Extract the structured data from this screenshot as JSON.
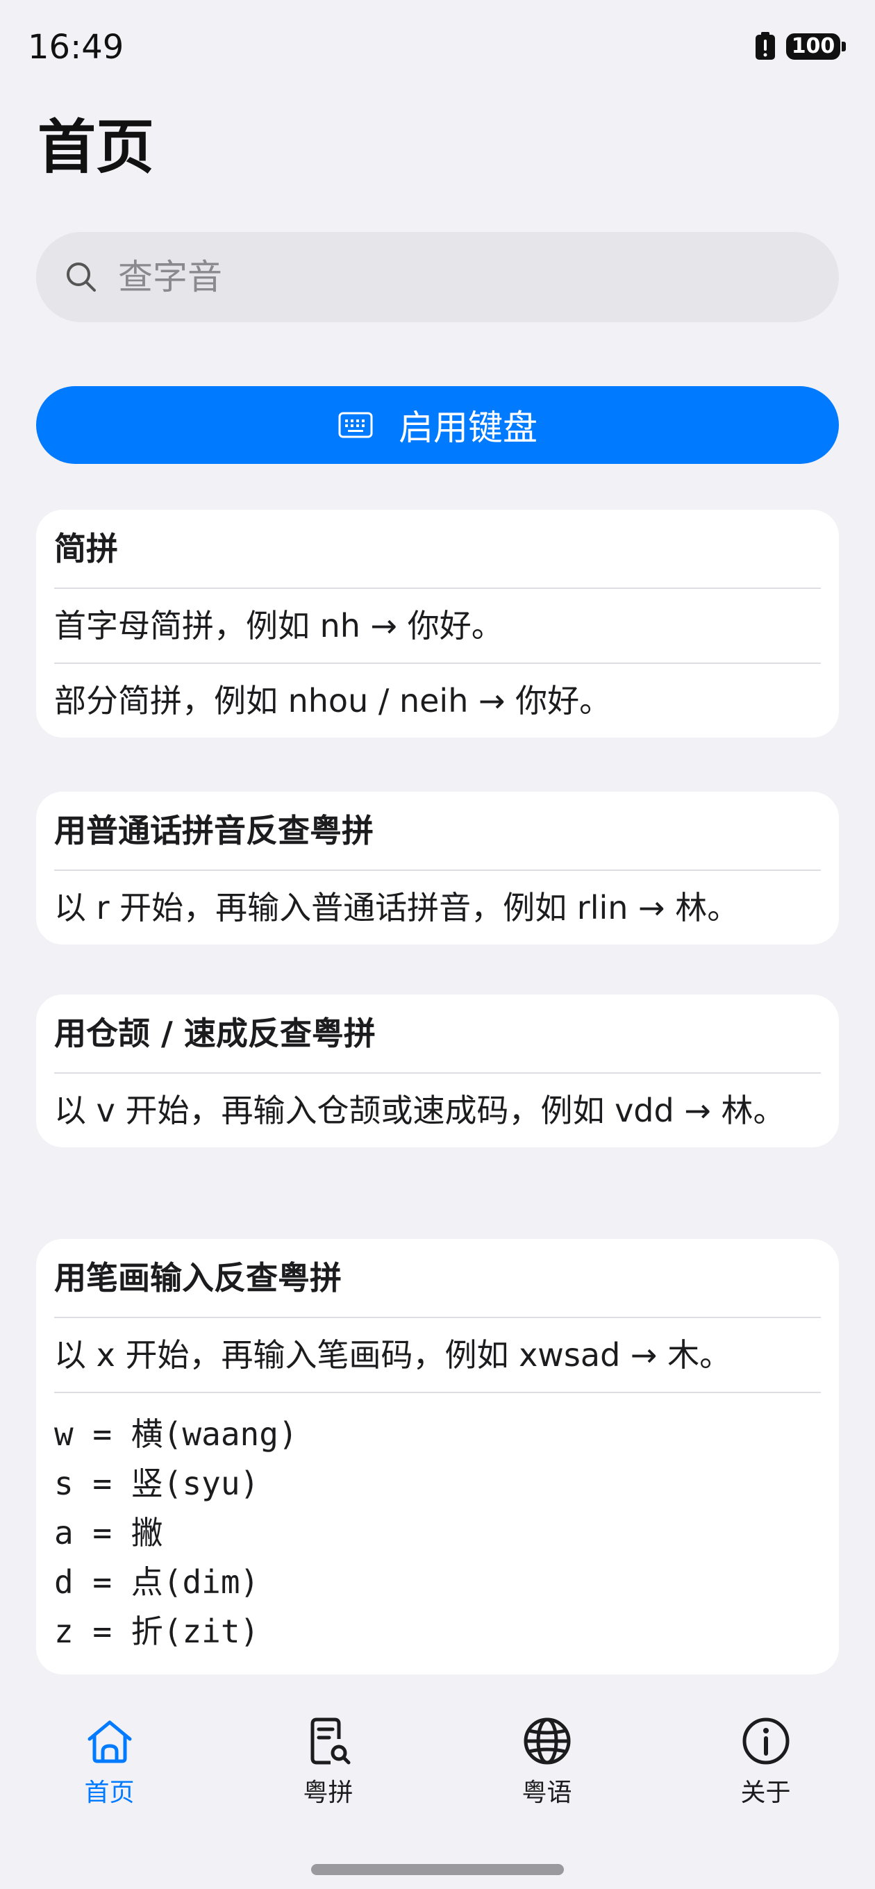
{
  "status": {
    "time": "16:49",
    "battery": "100"
  },
  "page": {
    "title": "首页"
  },
  "search": {
    "placeholder": "查字音",
    "value": ""
  },
  "primary_button": {
    "label": "启用键盘"
  },
  "cards": {
    "abbrev": {
      "title": "简拼",
      "rows": [
        "首字母简拼，例如 nh → 你好。",
        "部分简拼，例如 nhou / neih → 你好。"
      ]
    },
    "mandarin": {
      "title": "用普通话拼音反查粤拼",
      "rows": [
        "以 r 开始，再输入普通话拼音，例如 rlin → 林。"
      ]
    },
    "cangjie": {
      "title": "用仓颉 / 速成反查粤拼",
      "rows": [
        "以 v 开始，再输入仓颉或速成码，例如 vdd → 林。"
      ]
    },
    "stroke": {
      "title": "用笔画输入反查粤拼",
      "rows": [
        "以 x 开始，再输入笔画码，例如 xwsad → 木。"
      ],
      "code_lines": [
        "w = 横(waang)",
        "s = 竖(syu)",
        "a = 撇",
        "d = 点(dim)",
        "z = 折(zit)"
      ]
    }
  },
  "tabs": [
    {
      "label": "首页",
      "icon": "home-icon",
      "active": true
    },
    {
      "label": "粤拼",
      "icon": "document-search-icon",
      "active": false
    },
    {
      "label": "粤语",
      "icon": "globe-icon",
      "active": false
    },
    {
      "label": "关于",
      "icon": "info-icon",
      "active": false
    }
  ],
  "colors": {
    "accent": "#007aff",
    "background": "#f1f1f6",
    "card": "#ffffff",
    "search_bg": "#e5e5ea"
  }
}
